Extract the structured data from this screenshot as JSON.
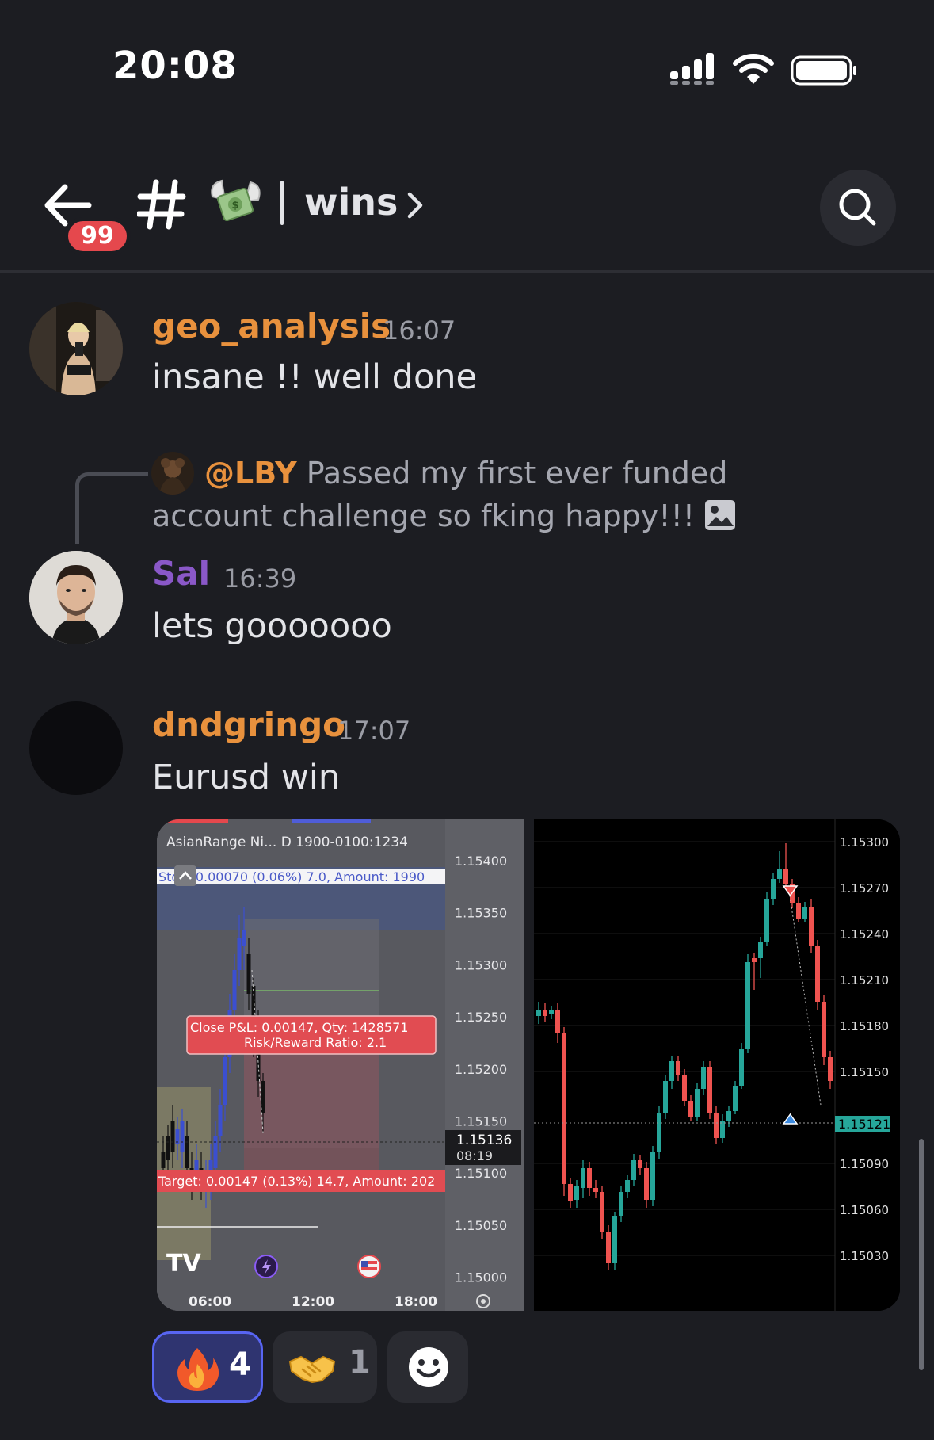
{
  "status_bar": {
    "time": "20:08"
  },
  "header": {
    "back_icon": "arrow-left-icon",
    "unread_badge": "99",
    "channel_prefix_icon": "hashtag-icon",
    "channel_emoji": "money-with-wings-icon",
    "channel_name": "wins",
    "search_icon": "search-icon"
  },
  "messages": [
    {
      "username": "geo_analysis",
      "time": "16:07",
      "text": "insane !! well done",
      "name_color": "#e8913d"
    },
    {
      "reply": {
        "mention": "@LBY",
        "text": "Passed my first ever funded account challenge so fking happy!!!",
        "attachment_icon": "image-icon"
      },
      "username": "Sal",
      "time": "16:39",
      "text": "lets gooooooo",
      "name_color": "#8a58c8"
    },
    {
      "username": "dndgringo",
      "time": "17:07",
      "text": "Eurusd win",
      "name_color": "#e8913d"
    }
  ],
  "attachment_left": {
    "indicator": "AsianRange Ni...  D 1900-0100:1234",
    "stop_label": "Stop: 0.00070 (0.06%) 7.0, Amount: 1990",
    "close_label": "Close P&L: 0.00147, Qty: 1428571",
    "rr_label": "Risk/Reward Ratio: 2.1",
    "target_label": "Target: 0.00147 (0.13%) 14.7, Amount: 202",
    "price_ticks": [
      "1.15400",
      "1.15350",
      "1.15300",
      "1.15250",
      "1.15200",
      "1.15150",
      "1.15100",
      "1.15050",
      "1.15000"
    ],
    "current_price": "1.15136",
    "countdown": "08:19",
    "time_ticks": [
      "06:00",
      "12:00",
      "18:00"
    ],
    "logo": "TV"
  },
  "attachment_right": {
    "price_ticks": [
      "1.15300",
      "1.15270",
      "1.15240",
      "1.15210",
      "1.15180",
      "1.15150",
      "1.15090",
      "1.15060",
      "1.15030"
    ],
    "current_price": "1.15121",
    "colors": {
      "up": "#26a69a",
      "down": "#ef5350"
    }
  },
  "reactions": [
    {
      "emoji": "fire-icon",
      "count": "4",
      "active": true
    },
    {
      "emoji": "handshake-icon",
      "count": "1",
      "active": false
    },
    {
      "emoji": "add-reaction-icon",
      "count": "",
      "active": false
    }
  ],
  "colors": {
    "background": "#1c1d22",
    "accent": "#5865f2",
    "badge": "#e5484d"
  }
}
